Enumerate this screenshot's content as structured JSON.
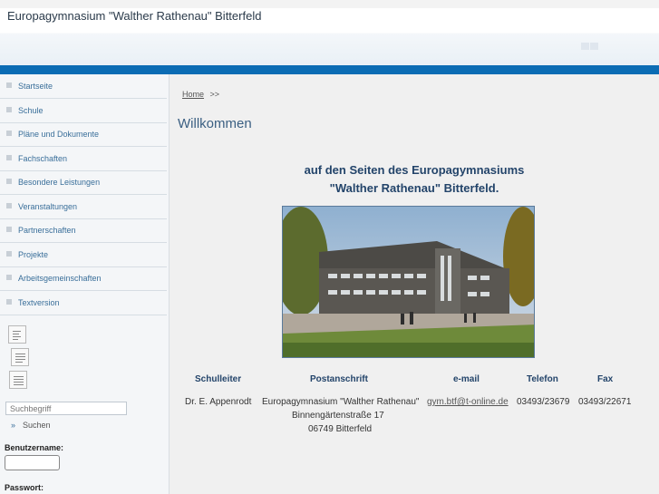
{
  "site": {
    "title": "Europagymnasium \"Walther Rathenau\" Bitterfeld"
  },
  "nav": {
    "items": [
      {
        "label": "Startseite"
      },
      {
        "label": "Schule"
      },
      {
        "label": "Pläne und Dokumente"
      },
      {
        "label": "Fachschaften"
      },
      {
        "label": "Besondere Leistungen"
      },
      {
        "label": "Veranstaltungen"
      },
      {
        "label": "Partnerschaften"
      },
      {
        "label": "Projekte"
      },
      {
        "label": "Arbeitsgemeinschaften"
      },
      {
        "label": "Textversion"
      }
    ]
  },
  "search": {
    "placeholder": "Suchbegriff",
    "button_label": "Suchen",
    "arrow": "»"
  },
  "login": {
    "username_label": "Benutzername:",
    "password_label": "Passwort:"
  },
  "breadcrumb": {
    "home": "Home",
    "separator": ">>"
  },
  "main": {
    "heading": "Willkommen",
    "intro_line1": "auf den Seiten des Europagymnasiums",
    "intro_line2": "\"Walther Rathenau\" Bitterfeld."
  },
  "contact": {
    "headers": {
      "schulleiter": "Schulleiter",
      "anschrift": "Postanschrift",
      "email": "e-mail",
      "telefon": "Telefon",
      "fax": "Fax"
    },
    "schulleiter": "Dr. E. Appenrodt",
    "anschrift_line1": "Europagymnasium \"Walther Rathenau\"",
    "anschrift_line2": "Binnengärtenstraße 17",
    "anschrift_line3": "06749 Bitterfeld",
    "email": "gym.btf@t-online.de",
    "telefon": "03493/23679",
    "fax": "03493/22671"
  },
  "colors": {
    "accent_bar": "#0b6cb4",
    "nav_text": "#3a6f9a",
    "heading": "#3b5f82",
    "table_header": "#23446a"
  },
  "icons": {
    "nav_bullet": "square-bullet-icon",
    "layout_buttons": [
      "align-left-icon",
      "align-center-icon",
      "align-justify-icon"
    ],
    "search_arrow": "double-chevron-right-icon"
  }
}
